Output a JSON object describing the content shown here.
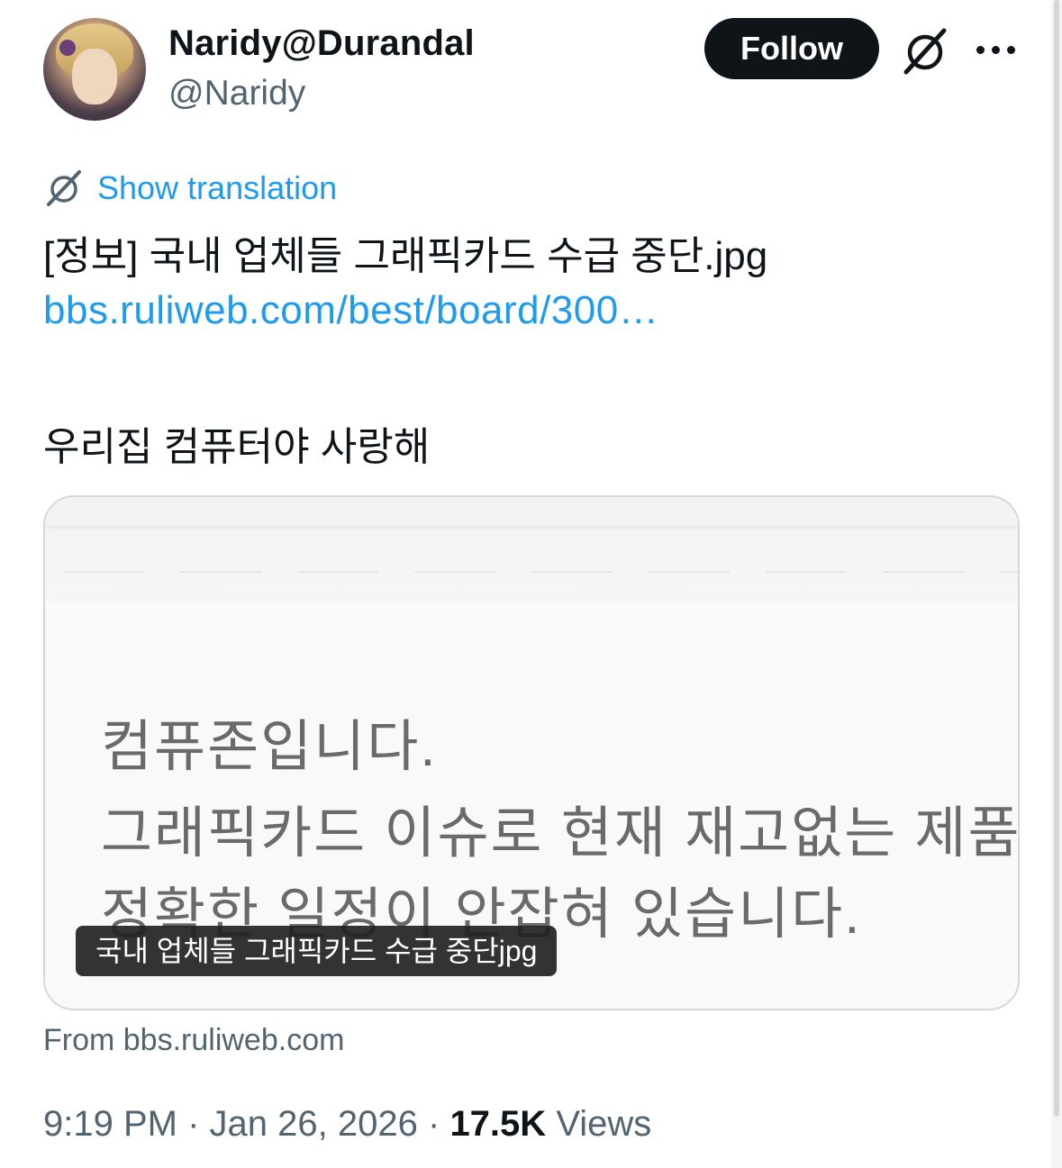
{
  "author": {
    "display_name": "Naridy@Durandal",
    "handle": "@Naridy"
  },
  "actions": {
    "follow_label": "Follow",
    "more_icon": "more-horizontal-icon",
    "grok_icon": "grok-icon"
  },
  "translation": {
    "label": "Show translation",
    "icon": "grok-icon"
  },
  "post": {
    "title": "[정보] 국내 업체들 그래픽카드 수급 중단.jpg",
    "url": "bbs.ruliweb.com/best/board/300…",
    "body": "우리집 컴퓨터야 사랑해"
  },
  "card": {
    "image_text": [
      "컴퓨존입니다.",
      "그래픽카드 이슈로 현재 재고없는 제품들",
      "정확한 일정이 안잡혀 있습니다."
    ],
    "caption": "국내 업체들 그래픽카드 수급 중단jpg",
    "source": "From bbs.ruliweb.com"
  },
  "meta": {
    "time": "9:19 PM",
    "separator": "·",
    "date": "Jan 26, 2026",
    "views_count": "17.5K",
    "views_label": "Views"
  },
  "colors": {
    "link": "#1d9bf0",
    "text": "#0f1419",
    "secondary": "#536471",
    "button": "#0f1419"
  }
}
